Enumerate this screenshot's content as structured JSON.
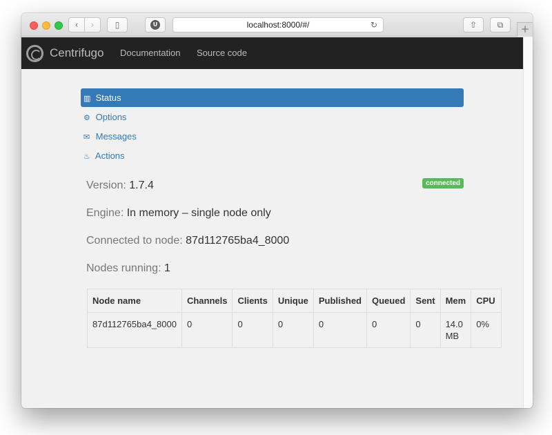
{
  "browser": {
    "url": "localhost:8000/#/",
    "extension_badge": "U"
  },
  "navbar": {
    "brand": "Centrifugo",
    "links": [
      "Documentation",
      "Source code"
    ]
  },
  "menu": [
    {
      "label": "Status",
      "icon": "bar-chart-icon",
      "glyph": "▥",
      "active": true
    },
    {
      "label": "Options",
      "icon": "cog-icon",
      "glyph": "⚙",
      "active": false
    },
    {
      "label": "Messages",
      "icon": "envelope-icon",
      "glyph": "✉",
      "active": false
    },
    {
      "label": "Actions",
      "icon": "fire-icon",
      "glyph": "♨",
      "active": false
    }
  ],
  "status": {
    "badge": "connected",
    "badge_color": "#5cb85c",
    "version_label": "Version:",
    "version": "1.7.4",
    "engine_label": "Engine:",
    "engine": "In memory – single node only",
    "node_label": "Connected to node:",
    "node": "87d112765ba4_8000",
    "nodes_label": "Nodes running:",
    "nodes": "1"
  },
  "table": {
    "headers": [
      "Node name",
      "Channels",
      "Clients",
      "Unique",
      "Published",
      "Queued",
      "Sent",
      "Mem",
      "CPU"
    ],
    "rows": [
      [
        "87d112765ba4_8000",
        "0",
        "0",
        "0",
        "0",
        "0",
        "0",
        "14.0 MB",
        "0%"
      ]
    ]
  },
  "colors": {
    "accent": "#337ab7",
    "navbar": "#222222"
  }
}
